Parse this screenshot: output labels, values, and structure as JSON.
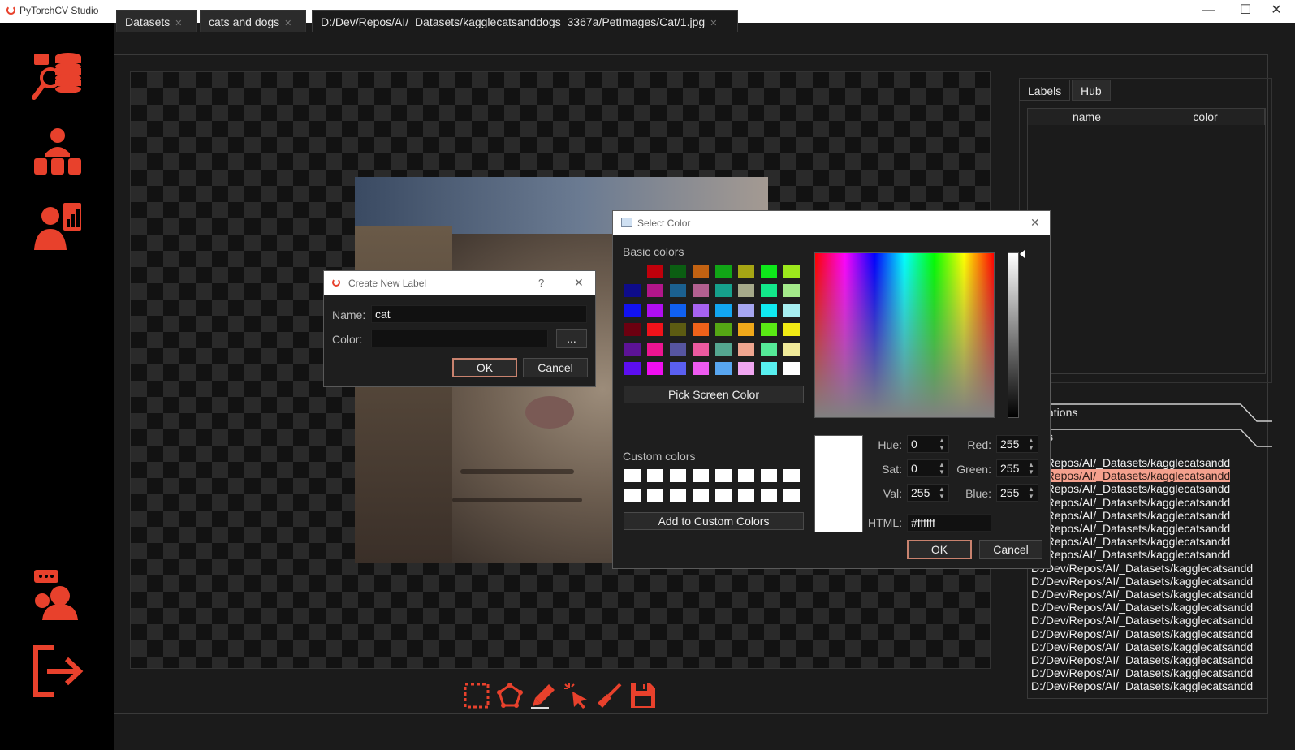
{
  "window": {
    "title": "PyTorchCV Studio",
    "minimize": "—",
    "maximize": "☐",
    "close": "✕"
  },
  "sidebar": {
    "items": [
      "datasets-icon",
      "team-icon",
      "analytics-icon",
      "support-icon",
      "logout-icon"
    ]
  },
  "tabs": [
    {
      "label": "Datasets",
      "close": "✕"
    },
    {
      "label": "cats and dogs",
      "close": "✕"
    },
    {
      "label": "D:/Dev/Repos/AI/_Datasets/kagglecatsanddogs_3367a/PetImages/Cat/1.jpg",
      "close": "✕"
    }
  ],
  "right_panel": {
    "tabs": [
      "Labels",
      "Hub"
    ],
    "table_headers": [
      "name",
      "color"
    ],
    "sections": [
      "ations",
      "s"
    ]
  },
  "file_list": {
    "items": [
      "ev/Repos/AI/_Datasets/kagglecatsandd",
      "ev/Repos/AI/_Datasets/kagglecatsandd",
      "ev/Repos/AI/_Datasets/kagglecatsandd",
      "ev/Repos/AI/_Datasets/kagglecatsandd",
      "ev/Repos/AI/_Datasets/kagglecatsandd",
      "ev/Repos/AI/_Datasets/kagglecatsandd",
      "ev/Repos/AI/_Datasets/kagglecatsandd",
      "ev/Repos/AI/_Datasets/kagglecatsandd",
      "D:/Dev/Repos/AI/_Datasets/kagglecatsandd",
      "D:/Dev/Repos/AI/_Datasets/kagglecatsandd",
      "D:/Dev/Repos/AI/_Datasets/kagglecatsandd",
      "D:/Dev/Repos/AI/_Datasets/kagglecatsandd",
      "D:/Dev/Repos/AI/_Datasets/kagglecatsandd",
      "D:/Dev/Repos/AI/_Datasets/kagglecatsandd",
      "D:/Dev/Repos/AI/_Datasets/kagglecatsandd",
      "D:/Dev/Repos/AI/_Datasets/kagglecatsandd",
      "D:/Dev/Repos/AI/_Datasets/kagglecatsandd",
      "D:/Dev/Repos/AI/_Datasets/kagglecatsandd"
    ],
    "selected_index": 1
  },
  "toolbar": {
    "tools": [
      "rectangle-tool-icon",
      "polygon-tool-icon",
      "marker-tool-icon",
      "magic-select-icon",
      "brush-icon",
      "save-icon"
    ]
  },
  "create_label_dialog": {
    "title": "Create New Label",
    "help": "?",
    "close": "✕",
    "name_label": "Name:",
    "name_value": "cat",
    "color_label": "Color:",
    "color_value": "",
    "browse": "...",
    "ok": "OK",
    "cancel": "Cancel"
  },
  "select_color_dialog": {
    "title": "Select Color",
    "close": "✕",
    "basic_colors_label": "Basic colors",
    "basic_colors": [
      "#1e1e1e",
      "#c0000b",
      "#0b5e12",
      "#c26212",
      "#11a516",
      "#a6a514",
      "#0ee81a",
      "#9de81c",
      "#0e0c8a",
      "#b2168a",
      "#1b6090",
      "#b26090",
      "#16a08c",
      "#a6a98a",
      "#12e88a",
      "#a4ea8a",
      "#1212f0",
      "#b00ef0",
      "#1060f0",
      "#a662f0",
      "#12a6f0",
      "#a6a6f0",
      "#10eaf0",
      "#a6eef0",
      "#6c0010",
      "#f0121a",
      "#5c5b12",
      "#ef621a",
      "#55a614",
      "#efa81a",
      "#5aea14",
      "#f0ea14",
      "#5c1396",
      "#ed1491",
      "#5655a0",
      "#ec5aa0",
      "#55a690",
      "#efa690",
      "#55ea98",
      "#f0ea9a",
      "#5c0ef0",
      "#f00ef0",
      "#5a5ff0",
      "#ee5af0",
      "#58a6f0",
      "#f0a6f0",
      "#58f0f0",
      "#ffffff"
    ],
    "pick_screen": "Pick Screen Color",
    "custom_colors_label": "Custom colors",
    "add_custom": "Add to Custom Colors",
    "hue_label": "Hue:",
    "hue": "0",
    "sat_label": "Sat:",
    "sat": "0",
    "val_label": "Val:",
    "val": "255",
    "red_label": "Red:",
    "red": "255",
    "green_label": "Green:",
    "green": "255",
    "blue_label": "Blue:",
    "blue": "255",
    "html_label": "HTML:",
    "html": "#ffffff",
    "ok": "OK",
    "cancel": "Cancel",
    "current_color": "#ffffff"
  },
  "accent_color": "#e8412c"
}
